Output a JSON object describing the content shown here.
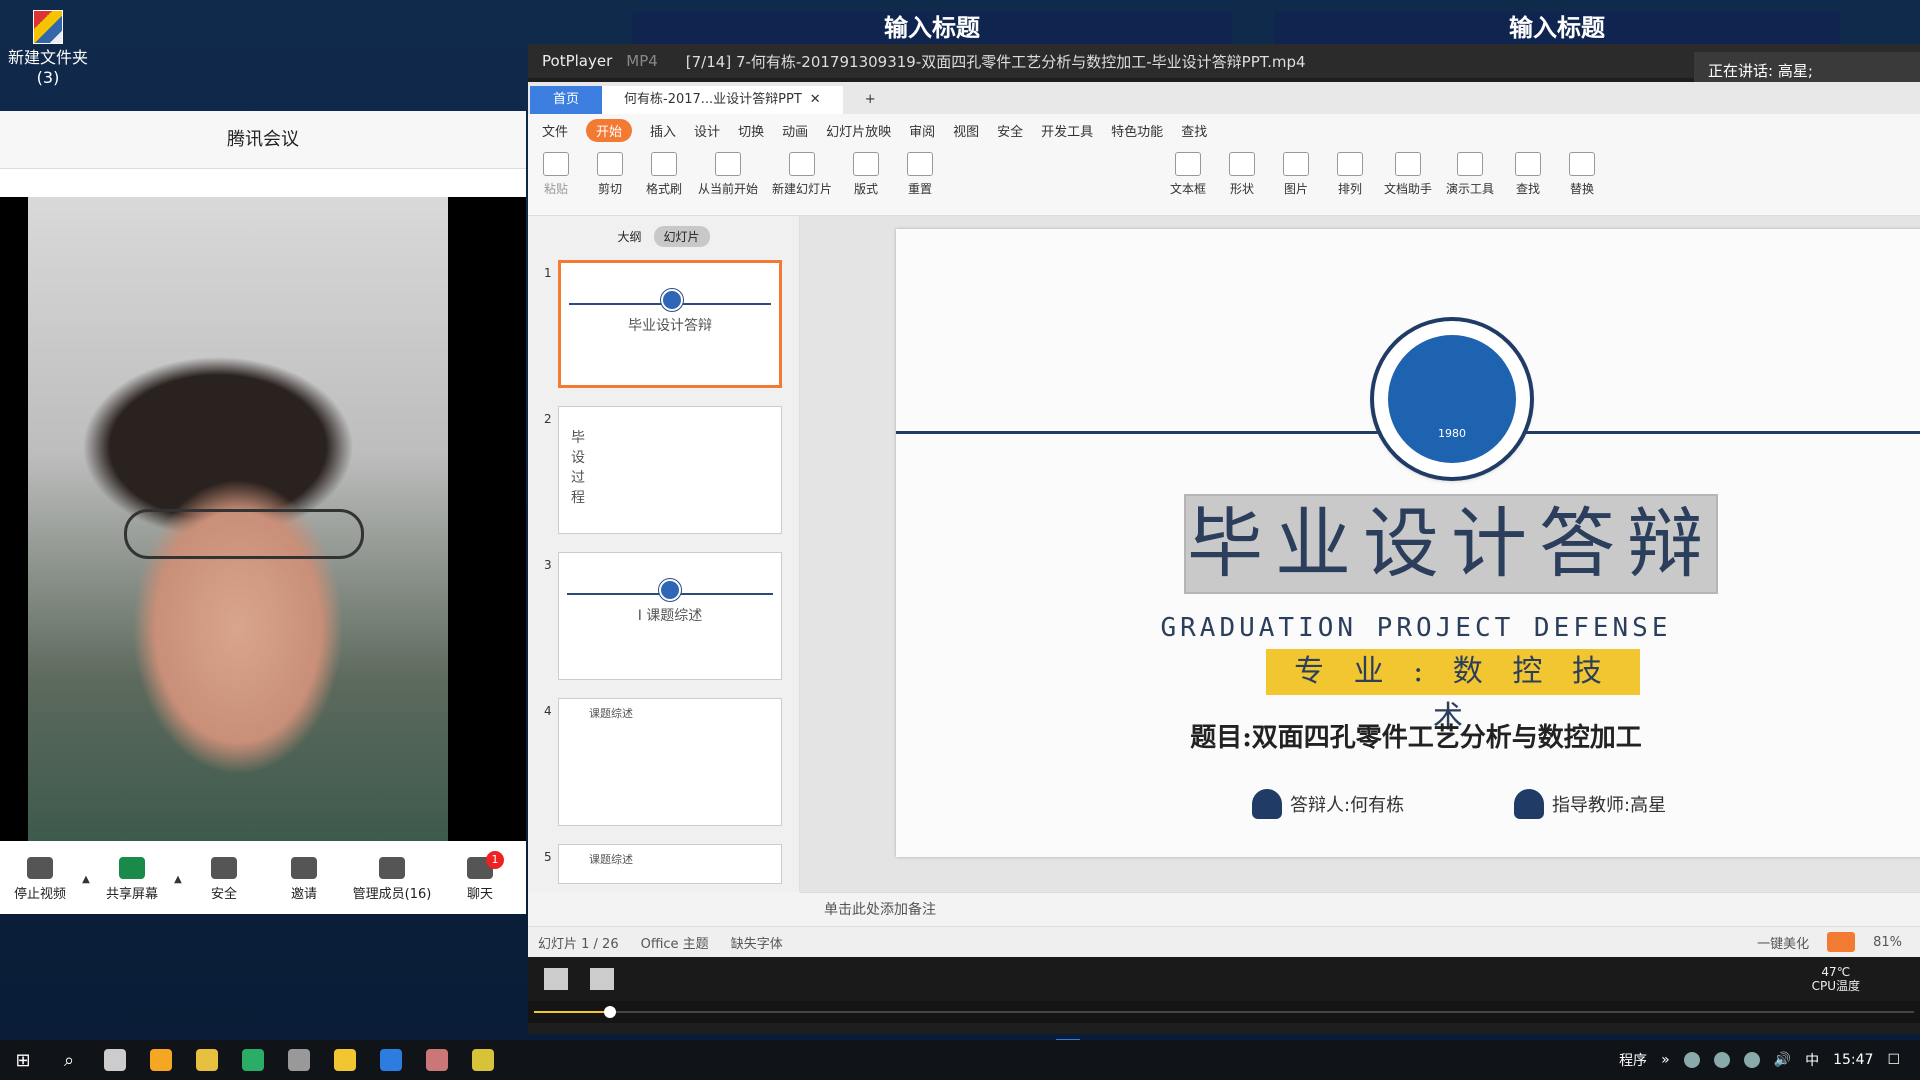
{
  "desktop": {
    "icon_label": "新建文件夹\n(3)",
    "icon_label_line1": "新建文件夹",
    "icon_label_line2": "(3)",
    "bg_title_1": "输入标题",
    "bg_title_2": "输入标题"
  },
  "meeting": {
    "title": "腾讯会议",
    "toolbar": [
      {
        "label": "停止视频",
        "icon": "camera-icon"
      },
      {
        "label": "共享屏幕",
        "icon": "share-screen-icon"
      },
      {
        "label": "安全",
        "icon": "shield-icon"
      },
      {
        "label": "邀请",
        "icon": "add-user-icon"
      },
      {
        "label": "管理成员(16)",
        "icon": "members-icon"
      },
      {
        "label": "聊天",
        "icon": "chat-icon",
        "badge": "1"
      }
    ]
  },
  "player": {
    "brand": "PotPlayer",
    "format": "MP4",
    "file_title": "[7/14] 7-何有栋-201791309319-双面四孔零件工艺分析与数控加工-毕业设计答辩PPT.mp4",
    "speaking_label": "正在讲话: 高星;",
    "progress_fraction": 0.055
  },
  "wps": {
    "home_tab": "首页",
    "doc_tab": "何有栋-2017...业设计答辩PPT",
    "menu": [
      "文件",
      "开始",
      "插入",
      "设计",
      "切换",
      "动画",
      "幻灯片放映",
      "审阅",
      "视图",
      "安全",
      "开发工具",
      "特色功能",
      "查找"
    ],
    "ribbon": [
      {
        "label": "粘贴",
        "gray": true
      },
      {
        "label": "剪切"
      },
      {
        "label": "格式刷"
      },
      {
        "label": "从当前开始"
      },
      {
        "label": "新建幻灯片"
      },
      {
        "label": "版式"
      },
      {
        "label": "重置"
      },
      {
        "label": "文本框"
      },
      {
        "label": "形状"
      },
      {
        "label": "图片"
      },
      {
        "label": "排列"
      },
      {
        "label": "文档助手"
      },
      {
        "label": "演示工具"
      },
      {
        "label": "查找"
      },
      {
        "label": "替换"
      }
    ],
    "left_tabs": [
      "大纲",
      "幻灯片"
    ],
    "thumbs": [
      {
        "num": "1",
        "title": "毕业设计答辩"
      },
      {
        "num": "2",
        "title": "毕设过程"
      },
      {
        "num": "3",
        "title": "I 课题综述"
      },
      {
        "num": "4",
        "title": "课题综述"
      },
      {
        "num": "5",
        "title": "课题综述"
      }
    ],
    "slide": {
      "title": "毕业设计答辩",
      "english": "GRADUATION PROJECT DEFENSE",
      "major": "专 业 : 数 控 技 术",
      "topic": "题目:双面四孔零件工艺分析与数控加工",
      "presenter": "答辩人:何有栋",
      "advisor": "指导教师:高星",
      "emblem_year": "1980"
    },
    "notes_placeholder": "单击此处添加备注",
    "status": {
      "slide_count": "幻灯片 1 / 26",
      "theme": "Office 主题",
      "missing_font": "缺失字体",
      "beautify": "一键美化",
      "zoom": "81%"
    }
  },
  "video_taskbar": {
    "temp": "47℃",
    "temp_label": "CPU温度"
  },
  "taskbar": {
    "tray_text": "程序",
    "ime": "中",
    "clock": "15:47"
  }
}
